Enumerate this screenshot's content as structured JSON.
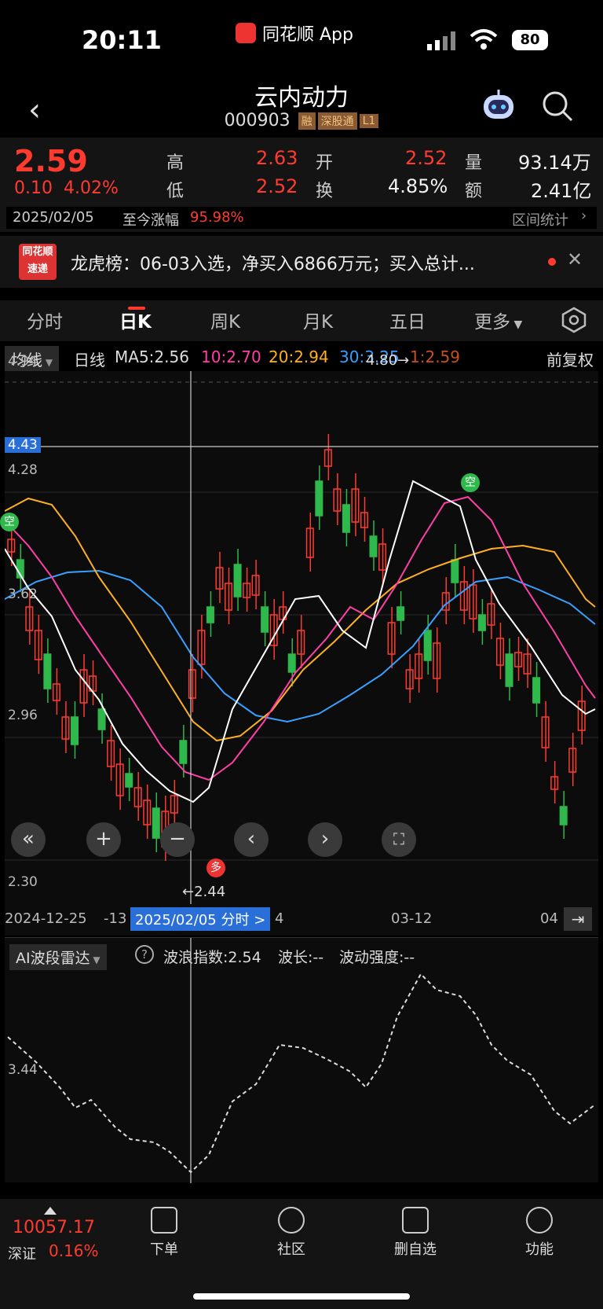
{
  "status": {
    "time": "20:11",
    "app": "同花顺 App",
    "battery": "80"
  },
  "header": {
    "title": "云内动力",
    "code": "000903",
    "tags": [
      "融",
      "深股通",
      "L1"
    ]
  },
  "quote": {
    "last": "2.59",
    "change": "0.10",
    "pct": "4.02%",
    "high_label": "高",
    "high": "2.63",
    "low_label": "低",
    "low": "2.52",
    "open_label": "开",
    "open": "2.52",
    "turnover_label": "换",
    "turnover": "4.85%",
    "volume_label": "量",
    "volume": "93.14万",
    "amount_label": "额",
    "amount": "2.41亿",
    "date": "2025/02/05",
    "since_label": "至今涨幅",
    "since_value": "95.98%",
    "interval_label": "区间统计"
  },
  "ad": {
    "badge_top": "同花顺",
    "badge_bottom": "速递",
    "text": "龙虎榜：06-03入选，净买入6866万元；买入总计..."
  },
  "tabs": [
    "分时",
    "日K",
    "周K",
    "月K",
    "五日",
    "更多"
  ],
  "ma": {
    "selector": "均线",
    "period": "日线",
    "ma5": "MA5:2.56",
    "ma10": "10:2.70",
    "ma20": "20:2.94",
    "ma30": "30:3.25",
    "ma1": "1:2.59",
    "adjust": "前复权",
    "colors": {
      "ma5": "#ffffff",
      "ma10": "#ff3fa5",
      "ma20": "#ffb020",
      "ma30": "#3aa0ff",
      "ma1": "#c8501e"
    }
  },
  "chart": {
    "y_labels": [
      "4.94",
      "4.28",
      "3.62",
      "2.96",
      "2.30"
    ],
    "cross_price": "4.43",
    "max_label": "4.80→",
    "min_label": "←2.44",
    "sell_marker": "空",
    "buy_marker": "多",
    "cross_date": "2025/02/05 分时 >",
    "x_labels": [
      "2024-12-25",
      "-13",
      "4",
      "03-12",
      "04"
    ],
    "up_color": "#ff3b30",
    "down_color": "#2fb84b"
  },
  "indicator": {
    "selector": "AI波段雷达",
    "wave_index": "波浪指数:2.54",
    "wave_len": "波长:--",
    "wave_strength": "波动强度:--",
    "y_label": "3.44"
  },
  "bottom": {
    "index_value": "10057.17",
    "index_name": "深证",
    "index_pct": "0.16%",
    "buttons": [
      "下单",
      "社区",
      "删自选",
      "功能"
    ]
  }
}
